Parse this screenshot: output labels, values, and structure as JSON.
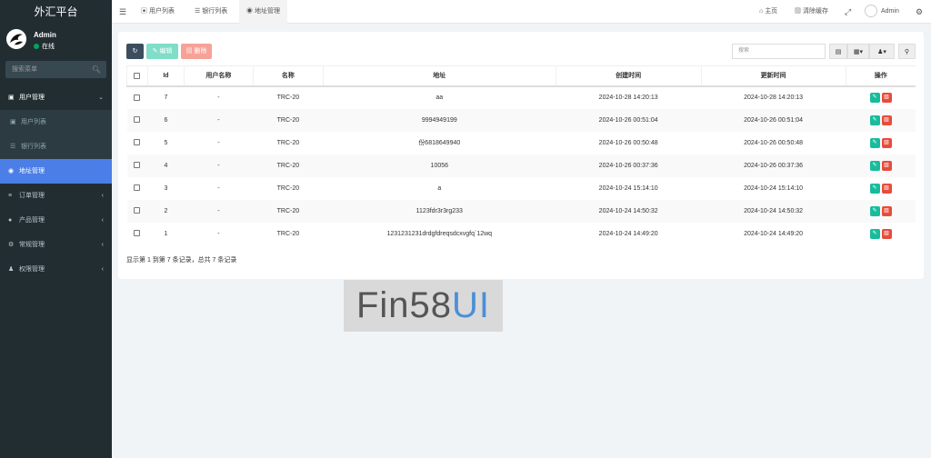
{
  "sidebar": {
    "brand": "外汇平台",
    "user": {
      "name": "Admin",
      "status": "在线"
    },
    "search_placeholder": "搜索菜单",
    "menu": [
      {
        "label": "用户管理"
      },
      {
        "label": "用户列表"
      },
      {
        "label": "银行列表"
      },
      {
        "label": "地址管理"
      },
      {
        "label": "订单管理"
      },
      {
        "label": "产品管理"
      },
      {
        "label": "常规管理"
      },
      {
        "label": "权限管理"
      }
    ]
  },
  "topbar": {
    "tabs": [
      {
        "label": "用户列表"
      },
      {
        "label": "银行列表"
      },
      {
        "label": "地址管理"
      }
    ],
    "home": "主页",
    "clear_cache": "清除缓存",
    "admin": "Admin"
  },
  "toolbar": {
    "edit": "编辑",
    "delete": "删除",
    "search_placeholder": "搜索"
  },
  "table": {
    "headers": [
      "Id",
      "用户名称",
      "名称",
      "地址",
      "创建时间",
      "更新时间",
      "操作"
    ],
    "rows": [
      {
        "id": "7",
        "user": "-",
        "name": "TRC-20",
        "address": "aa",
        "created": "2024-10-28 14:20:13",
        "updated": "2024-10-28 14:20:13"
      },
      {
        "id": "6",
        "user": "-",
        "name": "TRC-20",
        "address": "9994949199",
        "created": "2024-10-26 00:51:04",
        "updated": "2024-10-26 00:51:04"
      },
      {
        "id": "5",
        "user": "-",
        "name": "TRC-20",
        "address": "份6818649940",
        "created": "2024-10-26 00:50:48",
        "updated": "2024-10-26 00:50:48"
      },
      {
        "id": "4",
        "user": "-",
        "name": "TRC-20",
        "address": "10056",
        "created": "2024-10-26 00:37:36",
        "updated": "2024-10-26 00:37:36"
      },
      {
        "id": "3",
        "user": "-",
        "name": "TRC-20",
        "address": "a",
        "created": "2024-10-24 15:14:10",
        "updated": "2024-10-24 15:14:10"
      },
      {
        "id": "2",
        "user": "-",
        "name": "TRC-20",
        "address": "1123fdr3r3rg233",
        "created": "2024-10-24 14:50:32",
        "updated": "2024-10-24 14:50:32"
      },
      {
        "id": "1",
        "user": "-",
        "name": "TRC-20",
        "address": "1231231231drdgfdreqsdcxvgfq`12wq",
        "created": "2024-10-24 14:49:20",
        "updated": "2024-10-24 14:49:20"
      }
    ],
    "footer": "显示第 1 到第 7 条记录，总共 7 条记录"
  },
  "watermark": {
    "main": "Fin58",
    "accent": "UI"
  }
}
